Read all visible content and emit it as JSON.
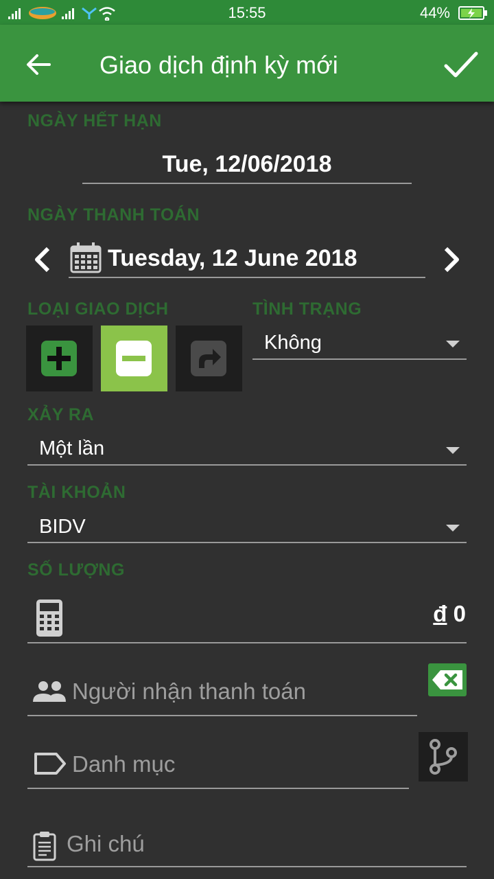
{
  "status_bar": {
    "time": "15:55",
    "battery": "44%"
  },
  "app_bar": {
    "title": "Giao dịch định kỳ mới",
    "back_icon": "arrow-left-icon",
    "confirm_icon": "check-icon"
  },
  "colors": {
    "primary": "#3a943f",
    "label_green": "#2e6b32",
    "selected_type": "#8bc34a",
    "background": "#303030"
  },
  "expiry": {
    "label": "NGÀY HẾT HẠN",
    "value": "Tue, 12/06/2018"
  },
  "payment_date": {
    "label": "NGÀY THANH TOÁN",
    "value": "Tuesday, 12 June 2018"
  },
  "transaction_type": {
    "label": "LOẠI GIAO DỊCH",
    "options": [
      "income",
      "expense",
      "transfer"
    ],
    "selected": "expense"
  },
  "status": {
    "label": "TÌNH TRẠNG",
    "value": "Không"
  },
  "occurrence": {
    "label": "XẢY RA",
    "value": "Một lần"
  },
  "account": {
    "label": "TÀI KHOẢN",
    "value": "BIDV"
  },
  "amount": {
    "label": "SỐ LƯỢNG",
    "currency": "đ",
    "value": "0"
  },
  "payee": {
    "placeholder": "Người nhận thanh toán"
  },
  "category": {
    "placeholder": "Danh mục"
  },
  "note": {
    "placeholder": "Ghi chú"
  }
}
